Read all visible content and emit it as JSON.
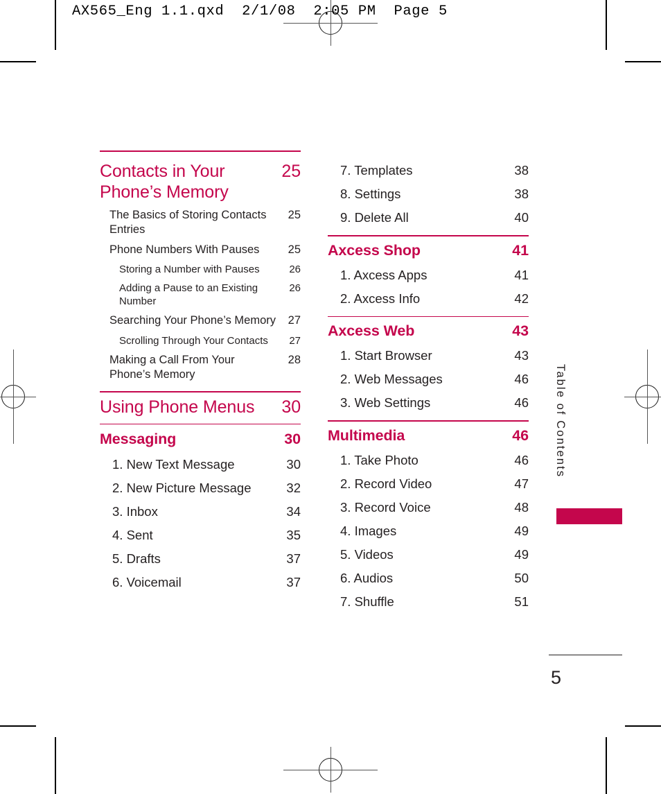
{
  "print_header": "AX565_Eng 1.1.qxd  2/1/08  2:05 PM  Page 5",
  "side_tab": {
    "label": "Table of Contents"
  },
  "folio": {
    "page_number": "5"
  },
  "colors": {
    "accent": "#c4064c",
    "text": "#231f20",
    "rule": "#c4064c"
  },
  "toc": {
    "left_column": [
      {
        "type": "section",
        "name": "contacts-in-your-phones-memory",
        "title": "Contacts in Your Phone’s Memory",
        "page": "25",
        "rule_above": true,
        "entries": [
          {
            "level": 1,
            "title": "The Basics of Storing Contacts Entries",
            "page": "25"
          },
          {
            "level": 1,
            "title": "Phone Numbers With Pauses",
            "page": "25"
          },
          {
            "level": 2,
            "title": "Storing a Number with Pauses",
            "page": "26"
          },
          {
            "level": 2,
            "title": "Adding a Pause to an Existing Number",
            "page": "26"
          },
          {
            "level": 1,
            "title": "Searching Your Phone’s Memory",
            "page": "27"
          },
          {
            "level": 2,
            "title": "Scrolling Through Your Contacts",
            "page": "27"
          },
          {
            "level": 1,
            "title": "Making a Call From Your Phone’s Memory",
            "page": "28"
          }
        ]
      },
      {
        "type": "section",
        "name": "using-phone-menus",
        "title": "Using Phone Menus",
        "page": "30",
        "rule_above": true,
        "entries": []
      },
      {
        "type": "section-small",
        "name": "messaging",
        "title": "Messaging",
        "page": "30",
        "rule_above": true,
        "entries": [
          {
            "level": "num",
            "title": "1. New Text Message",
            "page": "30"
          },
          {
            "level": "num",
            "title": "2. New Picture Message",
            "page": "32"
          },
          {
            "level": "num",
            "title": "3. Inbox",
            "page": "34"
          },
          {
            "level": "num",
            "title": "4. Sent",
            "page": "35"
          },
          {
            "level": "num",
            "title": "5. Drafts",
            "page": "37"
          },
          {
            "level": "num",
            "title": "6. Voicemail",
            "page": "37"
          }
        ]
      }
    ],
    "right_column": [
      {
        "type": "continuation",
        "name": "messaging-continued",
        "entries": [
          {
            "level": "num",
            "title": "7. Templates",
            "page": "38"
          },
          {
            "level": "num",
            "title": "8. Settings",
            "page": "38"
          },
          {
            "level": "num",
            "title": "9. Delete All",
            "page": "40"
          }
        ]
      },
      {
        "type": "section-small",
        "name": "axcess-shop",
        "title": "Axcess Shop",
        "page": "41",
        "rule_above": true,
        "entries": [
          {
            "level": "num",
            "title": "1. Axcess Apps",
            "page": "41"
          },
          {
            "level": "num",
            "title": "2. Axcess Info",
            "page": "42"
          }
        ]
      },
      {
        "type": "section-small",
        "name": "axcess-web",
        "title": "Axcess Web",
        "page": "43",
        "rule_above": true,
        "entries": [
          {
            "level": "num",
            "title": "1. Start Browser",
            "page": "43"
          },
          {
            "level": "num",
            "title": "2. Web Messages",
            "page": "46"
          },
          {
            "level": "num",
            "title": "3. Web Settings",
            "page": "46"
          }
        ]
      },
      {
        "type": "section-small",
        "name": "multimedia",
        "title": "Multimedia",
        "page": "46",
        "rule_above": true,
        "entries": [
          {
            "level": "num",
            "title": "1. Take Photo",
            "page": "46"
          },
          {
            "level": "num",
            "title": "2. Record Video",
            "page": "47"
          },
          {
            "level": "num",
            "title": "3. Record Voice",
            "page": "48"
          },
          {
            "level": "num",
            "title": "4. Images",
            "page": "49"
          },
          {
            "level": "num",
            "title": "5. Videos",
            "page": "49"
          },
          {
            "level": "num",
            "title": "6. Audios",
            "page": "50"
          },
          {
            "level": "num",
            "title": "7. Shuffle",
            "page": "51"
          }
        ]
      }
    ]
  }
}
